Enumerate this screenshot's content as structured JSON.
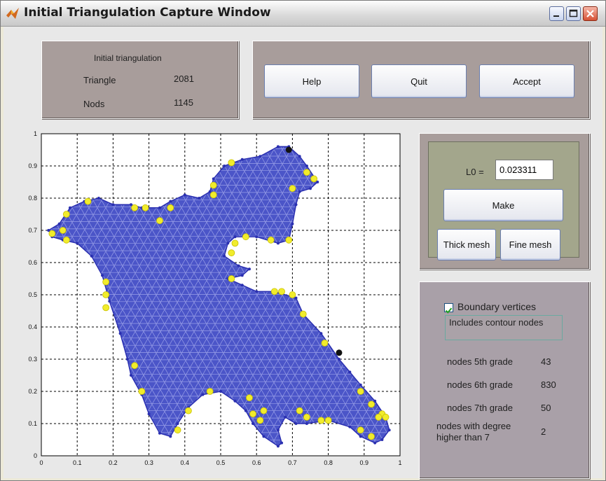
{
  "window": {
    "title": "Initial Triangulation Capture Window",
    "controls": [
      "minimize",
      "maximize",
      "close"
    ]
  },
  "info": {
    "heading": "Initial triangulation",
    "triangle_label": "Triangle",
    "triangle_value": "2081",
    "nods_label": "Nods",
    "nods_value": "1145"
  },
  "toolbar": {
    "help_label": "Help",
    "quit_label": "Quit",
    "accept_label": "Accept"
  },
  "mesh": {
    "l0_label": "L0 =",
    "l0_value": "0.023311",
    "make_label": "Make",
    "thick_label": "Thick mesh",
    "fine_label": "Fine mesh"
  },
  "stats": {
    "boundary_label": "Boundary vertices",
    "boundary_checked": true,
    "contour_text": "Includes contour nodes",
    "rows": [
      {
        "label": "nodes 5th grade",
        "value": "43"
      },
      {
        "label": "nodes 6th grade",
        "value": "830"
      },
      {
        "label": "nodes 7th grade",
        "value": "50"
      },
      {
        "label": "nodes with degree higher than 7",
        "value": "2"
      }
    ]
  },
  "chart_data": {
    "type": "scatter",
    "title": "",
    "xlabel": "",
    "ylabel": "",
    "xlim": [
      0,
      1
    ],
    "ylim": [
      0,
      1
    ],
    "grid": true,
    "x_ticks": [
      "0",
      "0.1",
      "0.2",
      "0.3",
      "0.4",
      "0.5",
      "0.6",
      "0.7",
      "0.8",
      "0.9",
      "1"
    ],
    "y_ticks": [
      "0",
      "0.1",
      "0.2",
      "0.3",
      "0.4",
      "0.5",
      "0.6",
      "0.7",
      "0.8",
      "0.9",
      "1"
    ],
    "colors": {
      "fill": "#4b55c8",
      "edge": "#2a2fb0",
      "mesh": "#9aa0e8",
      "degree5": "#f1ec2c",
      "degree_high": "#111111"
    },
    "boundary": [
      [
        0.02,
        0.7
      ],
      [
        0.05,
        0.72
      ],
      [
        0.08,
        0.77
      ],
      [
        0.12,
        0.79
      ],
      [
        0.16,
        0.8
      ],
      [
        0.2,
        0.78
      ],
      [
        0.25,
        0.78
      ],
      [
        0.28,
        0.77
      ],
      [
        0.33,
        0.77
      ],
      [
        0.36,
        0.79
      ],
      [
        0.4,
        0.81
      ],
      [
        0.44,
        0.8
      ],
      [
        0.47,
        0.82
      ],
      [
        0.48,
        0.86
      ],
      [
        0.51,
        0.9
      ],
      [
        0.56,
        0.92
      ],
      [
        0.61,
        0.93
      ],
      [
        0.66,
        0.96
      ],
      [
        0.69,
        0.96
      ],
      [
        0.72,
        0.93
      ],
      [
        0.74,
        0.9
      ],
      [
        0.77,
        0.85
      ],
      [
        0.75,
        0.83
      ],
      [
        0.72,
        0.82
      ],
      [
        0.71,
        0.78
      ],
      [
        0.7,
        0.72
      ],
      [
        0.69,
        0.67
      ],
      [
        0.66,
        0.66
      ],
      [
        0.6,
        0.68
      ],
      [
        0.54,
        0.68
      ],
      [
        0.52,
        0.66
      ],
      [
        0.51,
        0.62
      ],
      [
        0.55,
        0.59
      ],
      [
        0.58,
        0.58
      ],
      [
        0.56,
        0.56
      ],
      [
        0.52,
        0.55
      ],
      [
        0.56,
        0.53
      ],
      [
        0.6,
        0.51
      ],
      [
        0.65,
        0.51
      ],
      [
        0.71,
        0.49
      ],
      [
        0.73,
        0.44
      ],
      [
        0.78,
        0.38
      ],
      [
        0.83,
        0.3
      ],
      [
        0.86,
        0.26
      ],
      [
        0.89,
        0.22
      ],
      [
        0.93,
        0.17
      ],
      [
        0.96,
        0.12
      ],
      [
        0.97,
        0.08
      ],
      [
        0.95,
        0.05
      ],
      [
        0.93,
        0.04
      ],
      [
        0.89,
        0.06
      ],
      [
        0.86,
        0.09
      ],
      [
        0.8,
        0.11
      ],
      [
        0.74,
        0.1
      ],
      [
        0.71,
        0.1
      ],
      [
        0.68,
        0.12
      ],
      [
        0.66,
        0.08
      ],
      [
        0.67,
        0.04
      ],
      [
        0.66,
        0.03
      ],
      [
        0.62,
        0.06
      ],
      [
        0.59,
        0.1
      ],
      [
        0.57,
        0.14
      ],
      [
        0.54,
        0.17
      ],
      [
        0.5,
        0.2
      ],
      [
        0.45,
        0.19
      ],
      [
        0.41,
        0.15
      ],
      [
        0.38,
        0.1
      ],
      [
        0.36,
        0.06
      ],
      [
        0.33,
        0.07
      ],
      [
        0.3,
        0.13
      ],
      [
        0.28,
        0.19
      ],
      [
        0.25,
        0.25
      ],
      [
        0.24,
        0.3
      ],
      [
        0.22,
        0.38
      ],
      [
        0.19,
        0.48
      ],
      [
        0.17,
        0.56
      ],
      [
        0.14,
        0.62
      ],
      [
        0.1,
        0.66
      ],
      [
        0.06,
        0.67
      ],
      [
        0.03,
        0.68
      ]
    ],
    "degree5_points": [
      [
        0.03,
        0.69
      ],
      [
        0.06,
        0.7
      ],
      [
        0.07,
        0.75
      ],
      [
        0.13,
        0.79
      ],
      [
        0.26,
        0.77
      ],
      [
        0.29,
        0.77
      ],
      [
        0.36,
        0.77
      ],
      [
        0.33,
        0.73
      ],
      [
        0.48,
        0.84
      ],
      [
        0.48,
        0.81
      ],
      [
        0.53,
        0.91
      ],
      [
        0.74,
        0.88
      ],
      [
        0.76,
        0.86
      ],
      [
        0.7,
        0.83
      ],
      [
        0.54,
        0.66
      ],
      [
        0.53,
        0.63
      ],
      [
        0.57,
        0.68
      ],
      [
        0.64,
        0.67
      ],
      [
        0.69,
        0.67
      ],
      [
        0.53,
        0.55
      ],
      [
        0.65,
        0.51
      ],
      [
        0.67,
        0.51
      ],
      [
        0.7,
        0.5
      ],
      [
        0.73,
        0.44
      ],
      [
        0.79,
        0.35
      ],
      [
        0.89,
        0.2
      ],
      [
        0.92,
        0.16
      ],
      [
        0.95,
        0.13
      ],
      [
        0.96,
        0.12
      ],
      [
        0.94,
        0.12
      ],
      [
        0.89,
        0.08
      ],
      [
        0.92,
        0.06
      ],
      [
        0.8,
        0.11
      ],
      [
        0.78,
        0.11
      ],
      [
        0.74,
        0.12
      ],
      [
        0.72,
        0.14
      ],
      [
        0.62,
        0.14
      ],
      [
        0.61,
        0.11
      ],
      [
        0.59,
        0.13
      ],
      [
        0.58,
        0.18
      ],
      [
        0.47,
        0.2
      ],
      [
        0.41,
        0.14
      ],
      [
        0.38,
        0.08
      ],
      [
        0.28,
        0.2
      ],
      [
        0.26,
        0.28
      ],
      [
        0.18,
        0.46
      ],
      [
        0.18,
        0.5
      ],
      [
        0.18,
        0.54
      ],
      [
        0.07,
        0.67
      ]
    ],
    "degree_high_points": [
      [
        0.69,
        0.95
      ],
      [
        0.83,
        0.32
      ]
    ]
  }
}
